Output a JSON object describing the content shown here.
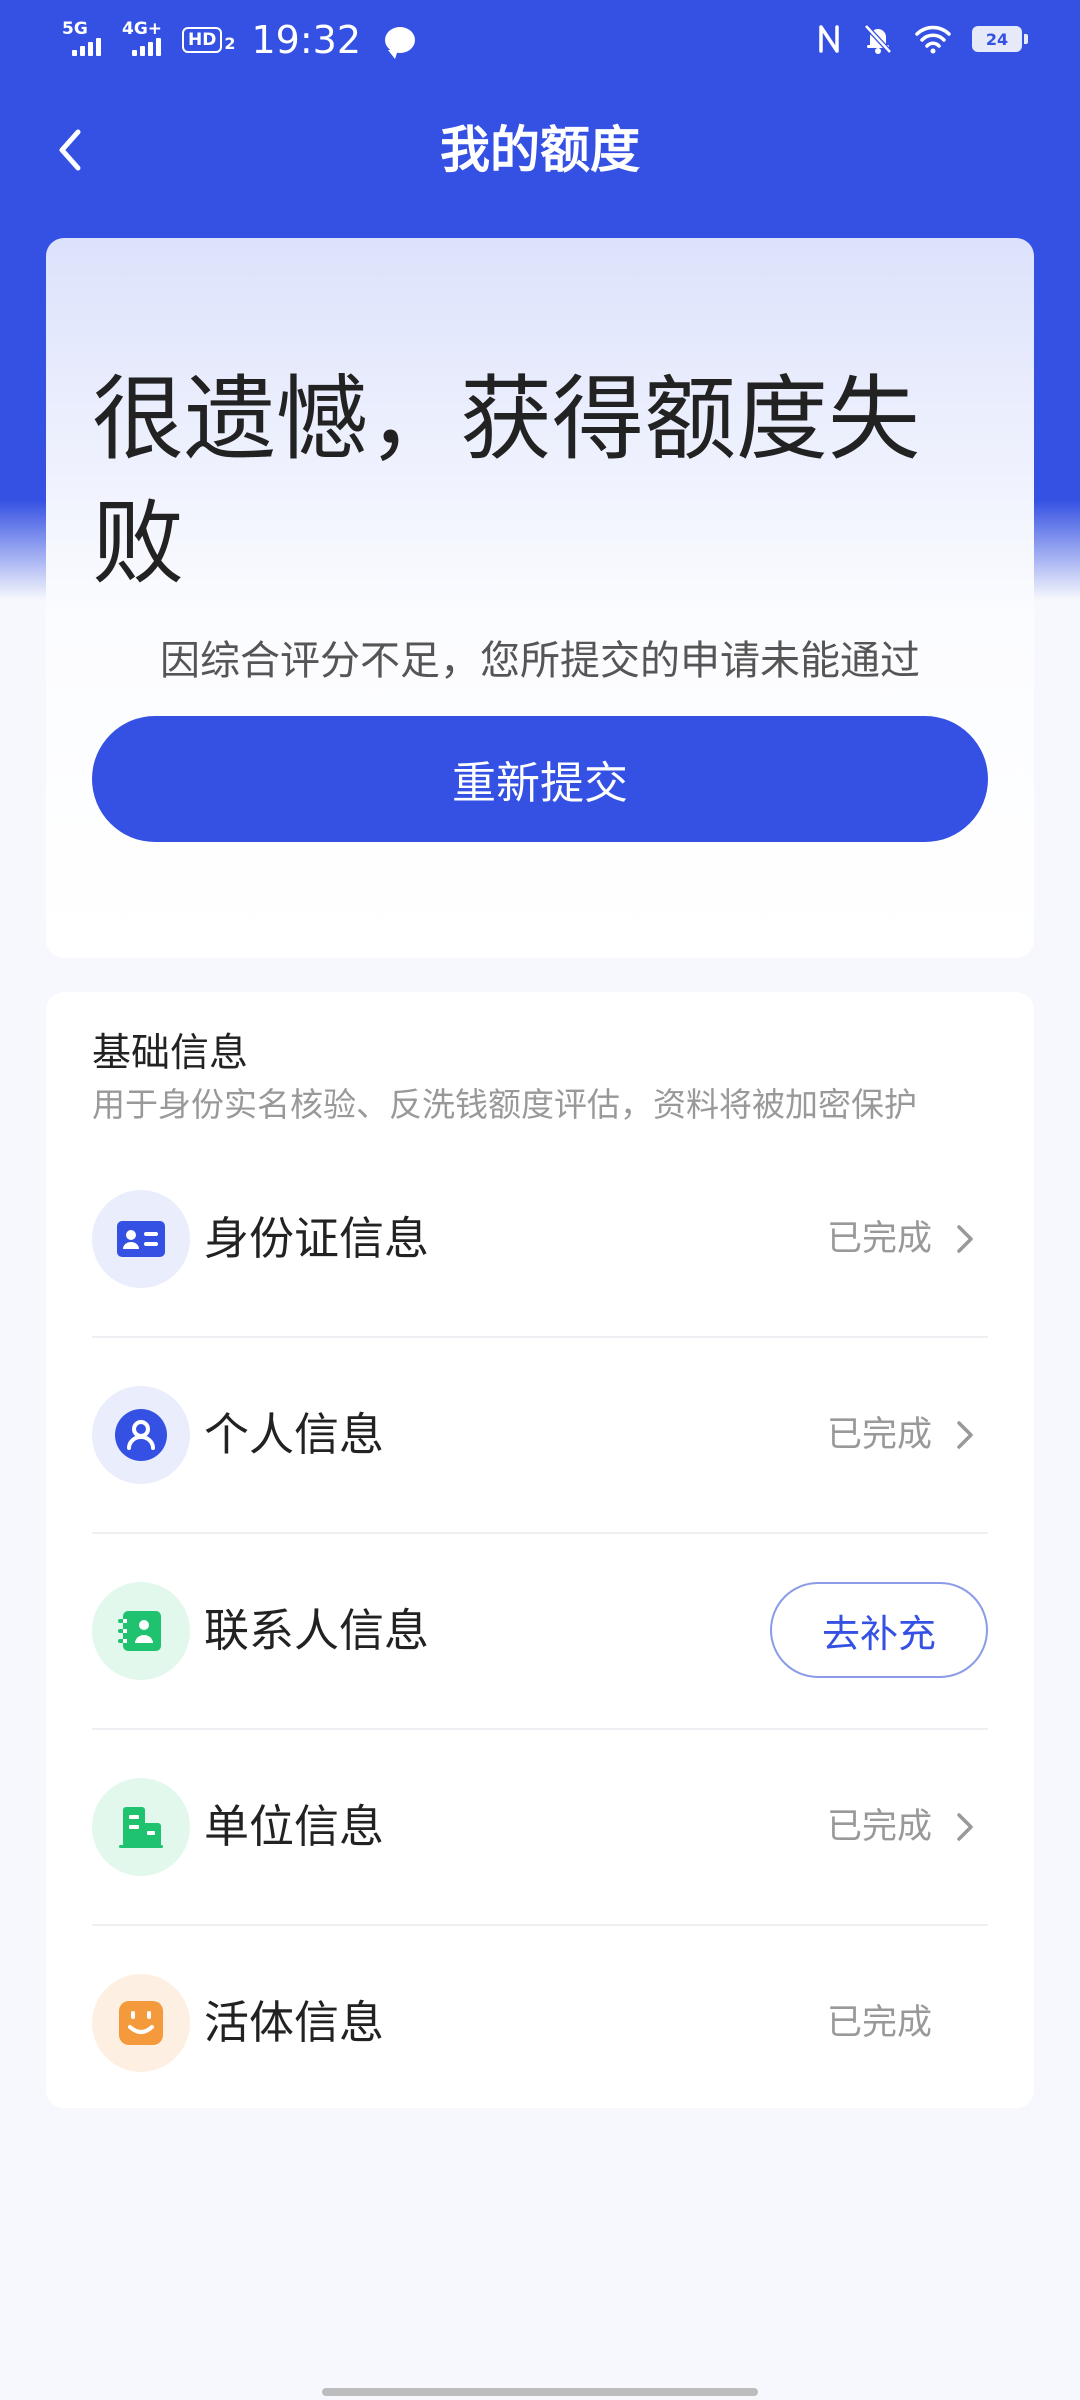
{
  "status_bar": {
    "signal1_label": "5G",
    "signal2_label": "4G+",
    "hd_label": "HD",
    "hd_sub": "2",
    "time": "19:32",
    "battery": "24"
  },
  "nav": {
    "title": "我的额度"
  },
  "result": {
    "title": "很遗憾，获得额度失败",
    "description": "因综合评分不足，您所提交的申请未能通过",
    "resubmit_label": "重新提交"
  },
  "basic_info": {
    "title": "基础信息",
    "subtitle": "用于身份实名核验、反洗钱额度评估，资料将被加密保护",
    "items": [
      {
        "label": "身份证信息",
        "status": "已完成",
        "icon": "id-card-icon"
      },
      {
        "label": "个人信息",
        "status": "已完成",
        "icon": "person-icon"
      },
      {
        "label": "联系人信息",
        "action": "去补充",
        "icon": "contact-icon"
      },
      {
        "label": "单位信息",
        "status": "已完成",
        "icon": "building-icon"
      },
      {
        "label": "活体信息",
        "status": "已完成",
        "icon": "face-icon"
      }
    ]
  },
  "colors": {
    "primary": "#3551e3",
    "contact_green": "#1fc36f",
    "face_orange": "#f59a3c"
  }
}
